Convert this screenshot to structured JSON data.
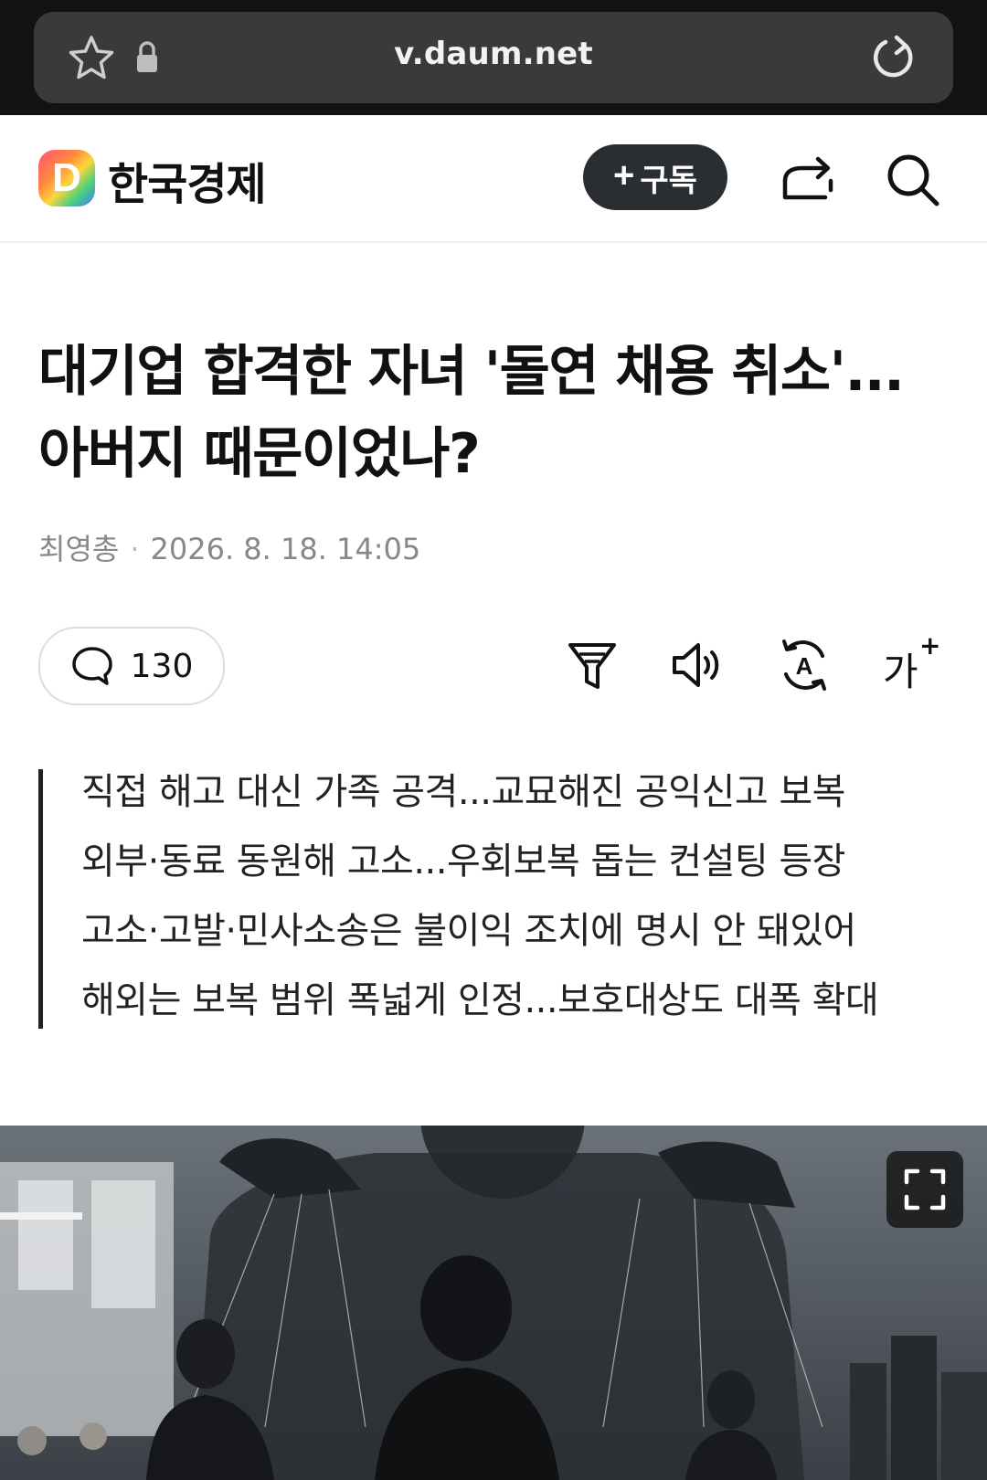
{
  "browser": {
    "url": "v.daum.net"
  },
  "header": {
    "press_name": "한국경제",
    "logo_letter": "D",
    "subscribe_label": "구독"
  },
  "article": {
    "headline_line1": "대기업 합격한 자녀 '돌연 채용 취소'...",
    "headline_line2": "아버지 때문이었나?",
    "author": "최영총",
    "datetime": "2026. 8. 18. 14:05",
    "comment_count": "130",
    "font_size_label": "가",
    "summary": [
      "직접 해고 대신 가족 공격...교묘해진 공익신고 보복",
      "외부·동료 동원해 고소...우회보복 돕는 컨설팅 등장",
      "고소·고발·민사소송은 불이익 조치에 명시 안 돼있어",
      "해외는 보복 범위 폭넓게 인정...보호대상도 대폭 확대"
    ]
  },
  "colors": {
    "browser_bg": "#121212",
    "url_pill": "#3a3a3c",
    "subscribe_bg": "#2a2d31",
    "summary_border": "#222222"
  },
  "icons": [
    "star-icon",
    "lock-icon",
    "reload-icon",
    "share-icon",
    "search-icon",
    "comment-icon",
    "summary-filter-icon",
    "speaker-icon",
    "translate-icon",
    "font-size-icon",
    "expand-icon"
  ]
}
